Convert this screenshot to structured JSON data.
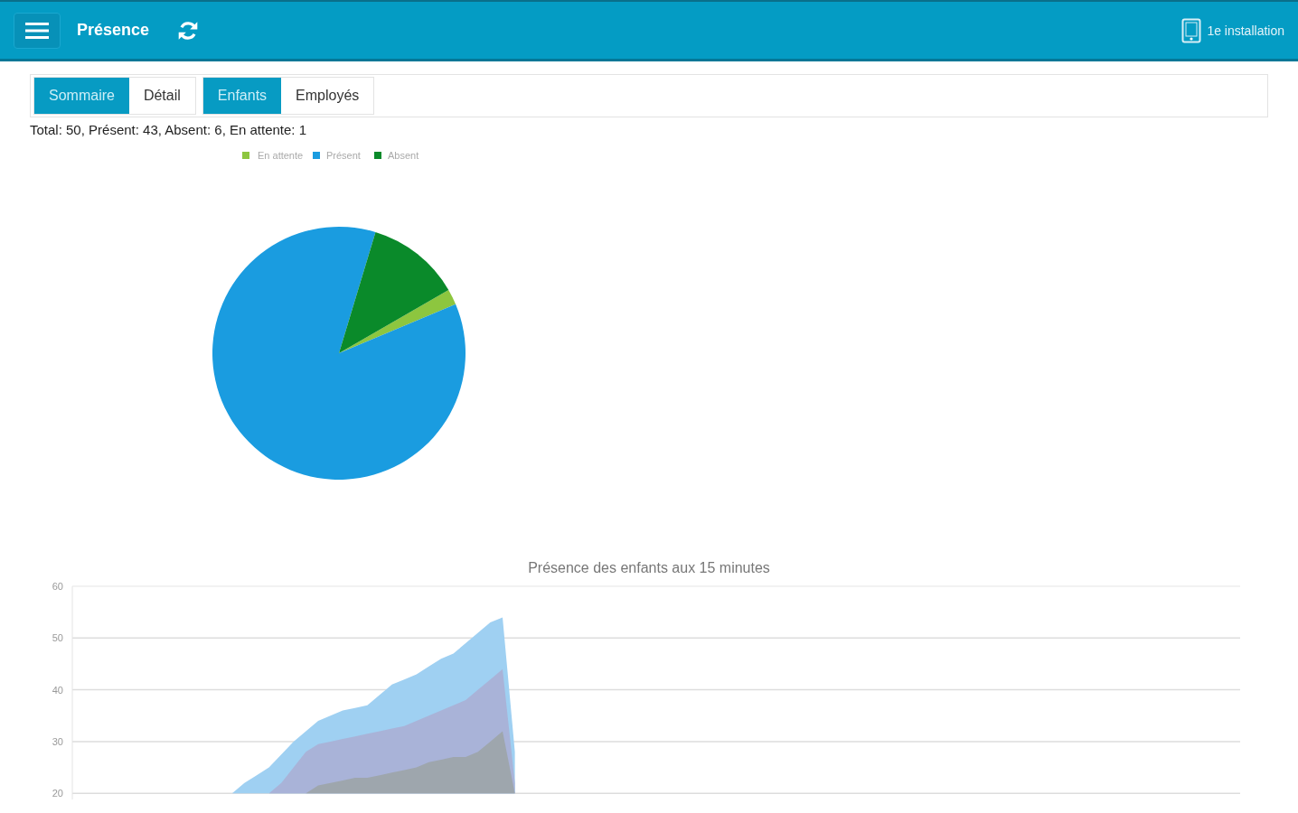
{
  "header": {
    "title": "Présence",
    "device_label": "1e installation"
  },
  "tab_groups": [
    {
      "tabs": [
        {
          "label": "Sommaire",
          "selected": true
        },
        {
          "label": "Détail",
          "selected": false
        }
      ]
    },
    {
      "tabs": [
        {
          "label": "Enfants",
          "selected": true
        },
        {
          "label": "Employés",
          "selected": false
        }
      ]
    }
  ],
  "summary": "Total: 50, Présent: 43, Absent: 6, En attente: 1",
  "pie": {
    "chart_data": {
      "type": "pie",
      "categories": [
        "En attente",
        "Présent",
        "Absent"
      ],
      "series": [
        {
          "values": [
            2,
            86,
            12
          ]
        }
      ],
      "legend": "top",
      "colors": [
        "#8dc63f",
        "#1a9ce0",
        "#0a8a2a"
      ]
    }
  },
  "area": {
    "chart_data": {
      "type": "area",
      "title": "Présence des enfants aux 15 minutes",
      "ylim": [
        20,
        60
      ],
      "yticks": [
        20,
        30,
        40,
        50,
        60
      ],
      "grid": true,
      "categories": [
        null,
        null,
        null,
        null,
        null,
        null,
        null,
        null,
        null,
        null,
        null,
        null,
        null,
        null,
        null,
        null,
        null,
        null,
        null,
        null,
        null,
        null,
        null,
        null,
        null,
        null,
        null,
        null,
        null,
        null,
        null,
        null,
        null,
        null,
        null,
        null,
        null,
        null,
        null,
        null,
        null,
        null,
        null,
        null,
        null,
        null,
        null,
        null,
        null,
        null,
        null,
        null,
        null,
        null,
        null,
        null,
        null,
        null,
        null,
        null,
        null,
        null,
        null,
        null,
        null,
        null,
        null,
        null,
        null,
        null,
        null,
        null,
        null,
        null,
        null,
        null,
        null,
        null,
        null,
        null,
        null,
        null,
        null,
        null,
        null,
        null,
        null,
        null,
        null,
        null,
        null,
        null,
        null,
        null,
        null,
        null
      ],
      "series": [
        {
          "color": "#9fd0f2",
          "values": [
            null,
            null,
            null,
            null,
            null,
            null,
            null,
            null,
            null,
            null,
            null,
            null,
            null,
            20,
            22,
            23.5,
            25,
            27.5,
            30,
            32,
            34,
            35,
            36,
            36.5,
            37,
            39,
            41,
            42,
            43,
            44.5,
            46,
            47,
            49,
            51,
            53,
            54,
            28,
            null,
            null,
            null,
            null,
            null,
            null,
            null,
            null,
            null,
            null,
            null,
            null,
            null,
            null,
            null,
            null,
            null,
            null,
            null,
            null,
            null,
            null,
            null,
            null,
            null,
            null,
            null,
            null,
            null,
            null,
            null,
            null,
            null,
            null,
            null,
            null,
            null,
            null,
            null,
            null,
            null,
            null,
            null,
            null,
            null,
            null,
            null,
            null,
            null,
            null,
            null,
            null,
            null,
            null,
            null,
            null,
            null,
            null,
            null
          ]
        },
        {
          "color": "#a9b3d8",
          "values": [
            null,
            null,
            null,
            null,
            null,
            null,
            null,
            null,
            null,
            null,
            null,
            null,
            null,
            null,
            null,
            null,
            20,
            22,
            25,
            28,
            29.5,
            30,
            30.5,
            31,
            31.5,
            32,
            32.5,
            33,
            34,
            35,
            36,
            37,
            38,
            40,
            42,
            44,
            22,
            null,
            null,
            null,
            null,
            null,
            null,
            null,
            null,
            null,
            null,
            null,
            null,
            null,
            null,
            null,
            null,
            null,
            null,
            null,
            null,
            null,
            null,
            null,
            null,
            null,
            null,
            null,
            null,
            null,
            null,
            null,
            null,
            null,
            null,
            null,
            null,
            null,
            null,
            null,
            null,
            null,
            null,
            null,
            null,
            null,
            null,
            null,
            null,
            null,
            null,
            null,
            null,
            null,
            null,
            null,
            null,
            null,
            null,
            null
          ]
        },
        {
          "color": "#9ea6ad",
          "values": [
            null,
            null,
            null,
            null,
            null,
            null,
            null,
            null,
            null,
            null,
            null,
            null,
            null,
            null,
            null,
            null,
            null,
            null,
            null,
            20,
            21.5,
            22,
            22.5,
            23,
            23,
            23.5,
            24,
            24.5,
            25,
            26,
            26.5,
            27,
            27,
            28,
            30,
            32,
            20,
            null,
            null,
            null,
            null,
            null,
            null,
            null,
            null,
            null,
            null,
            null,
            null,
            null,
            null,
            null,
            null,
            null,
            null,
            null,
            null,
            null,
            null,
            null,
            null,
            null,
            null,
            null,
            null,
            null,
            null,
            null,
            null,
            null,
            null,
            null,
            null,
            null,
            null,
            null,
            null,
            null,
            null,
            null,
            null,
            null,
            null,
            null,
            null,
            null,
            null,
            null,
            null,
            null,
            null,
            null,
            null,
            null,
            null,
            null
          ]
        }
      ]
    }
  }
}
